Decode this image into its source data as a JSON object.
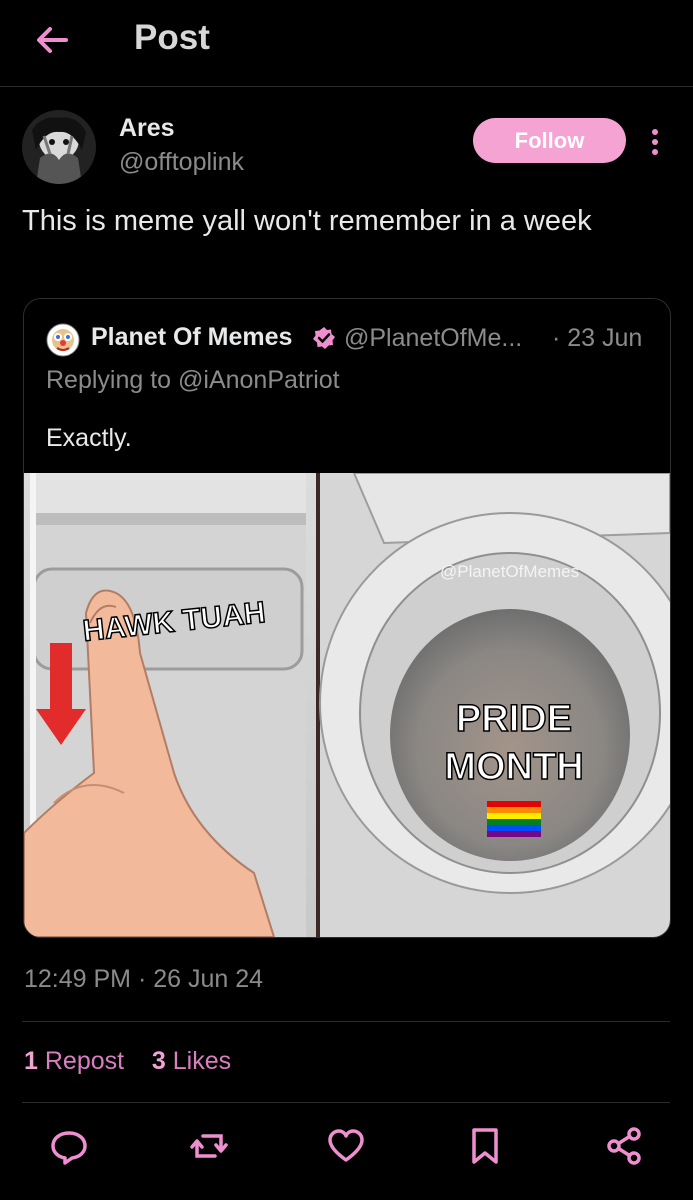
{
  "header": {
    "title": "Post"
  },
  "post": {
    "author_name": "Ares",
    "author_handle": "@offtoplink",
    "follow_label": "Follow",
    "text": "This is meme yall won't remember in a week",
    "timestamp": "12:49 PM · 26 Jun 24",
    "reposts_count": "1",
    "reposts_label": "Repost",
    "likes_count": "3",
    "likes_label": "Likes"
  },
  "quote": {
    "name": "Planet Of Memes",
    "handle": "@PlanetOfMe...",
    "date": "· 23 Jun",
    "replying_to": "Replying to @iAnonPatriot",
    "text": "Exactly.",
    "image": {
      "watermark": "@PlanetOfMemes",
      "left_caption": "HAWK TUAH",
      "right_caption_line1": "PRIDE",
      "right_caption_line2": "MONTH"
    }
  },
  "colors": {
    "accent": "#f5a3d3",
    "background": "#000000",
    "muted": "#8b8b8b"
  },
  "icons": [
    "back-arrow-icon",
    "more-vertical-icon",
    "verified-badge-icon",
    "reply-icon",
    "repost-icon",
    "like-icon",
    "bookmark-icon",
    "share-icon",
    "rainbow-flag-icon"
  ]
}
